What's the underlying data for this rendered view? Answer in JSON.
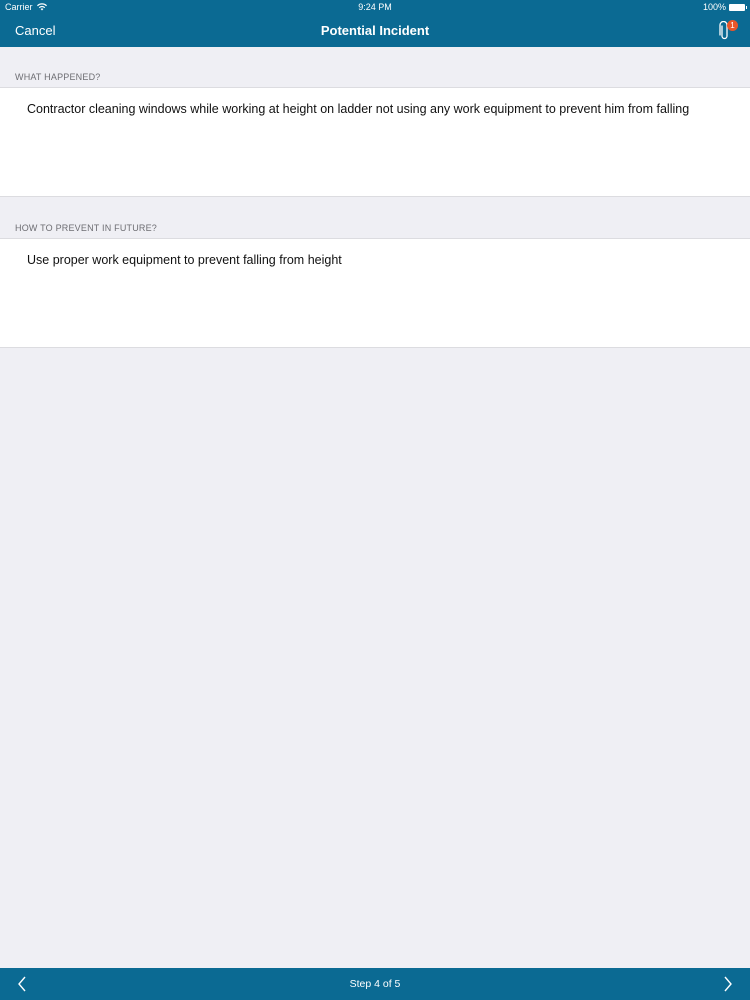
{
  "status_bar": {
    "carrier": "Carrier",
    "time": "9:24 PM",
    "battery": "100%"
  },
  "nav_bar": {
    "cancel_label": "Cancel",
    "title": "Potential Incident",
    "attachment_count": "1"
  },
  "sections": [
    {
      "header": "WHAT HAPPENED?",
      "text": "Contractor cleaning windows while working at height on ladder not using any work equipment to prevent him from falling"
    },
    {
      "header": "HOW TO PREVENT IN FUTURE?",
      "text": "Use proper work equipment to prevent falling from height"
    }
  ],
  "toolbar": {
    "step_label": "Step 4 of 5"
  },
  "colors": {
    "bar": "#0b6a93",
    "badge": "#e8562a",
    "background": "#efeff4"
  }
}
